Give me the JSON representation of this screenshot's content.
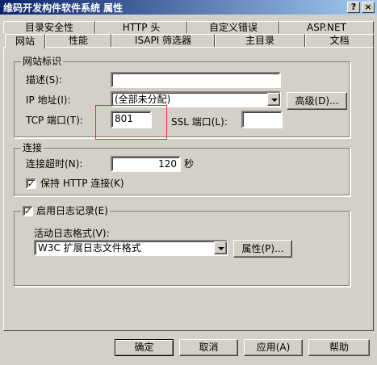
{
  "window": {
    "title": "维码开发构件软件系统 属性",
    "help_glyph": "?",
    "close_glyph": "×"
  },
  "tabs": {
    "row1": [
      "目录安全性",
      "HTTP 头",
      "自定义错误",
      "ASP.NET"
    ],
    "row2": [
      "网站",
      "性能",
      "ISAPI 筛选器",
      "主目录",
      "文档"
    ]
  },
  "site_identity": {
    "group_label": "网站标识",
    "description_label": "描述(S):",
    "description_value": "",
    "ip_label": "IP 地址(I):",
    "ip_value": "(全部未分配)",
    "advanced_button": "高级(D)...",
    "tcp_label": "TCP 端口(T):",
    "tcp_value": "801",
    "ssl_label": "SSL 端口(L):",
    "ssl_value": ""
  },
  "connections": {
    "group_label": "连接",
    "timeout_label": "连接超时(N):",
    "timeout_value": "120",
    "timeout_unit": "秒",
    "keepalive_label": "保持 HTTP 连接(K)",
    "keepalive_checked": true
  },
  "logging": {
    "enable_label": "启用日志记录(E)",
    "enable_checked": true,
    "format_label": "活动日志格式(V):",
    "format_value": "W3C 扩展日志文件格式",
    "properties_button": "属性(P)..."
  },
  "footer": {
    "ok": "确定",
    "cancel": "取消",
    "apply": "应用(A)",
    "help": "帮助"
  },
  "colors": {
    "dialog_bg": "#d4d0c8",
    "titlebar_start": "#0a246a",
    "titlebar_end": "#a6caf0",
    "highlight_box": "#e03030"
  }
}
